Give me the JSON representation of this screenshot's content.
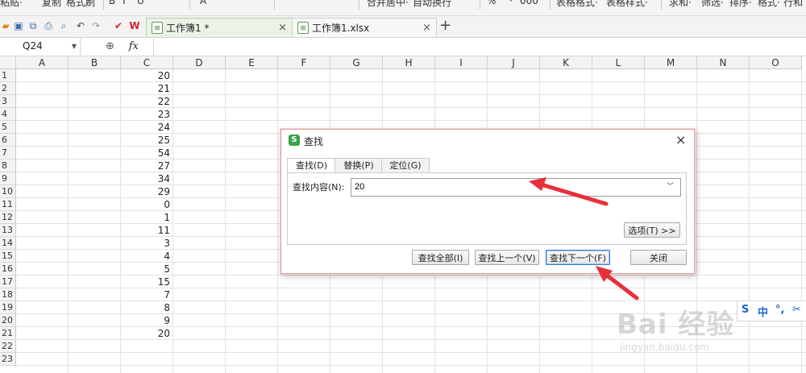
{
  "ribbon": {
    "items": [
      "粘贴·",
      "复制",
      "格式刷",
      "B",
      "I",
      "U",
      "A",
      "合并居中·",
      "自动换行",
      "%",
      "·",
      "000",
      "表格格式·",
      "表格样式·",
      "求和·",
      "筛选·",
      "排序·",
      "格式·",
      "行和"
    ]
  },
  "tabs": [
    {
      "label": "工作簿1 *",
      "active": true
    },
    {
      "label": "工作簿1.xlsx",
      "active": false
    }
  ],
  "tab_close": "×",
  "new_tab": "+",
  "cell_reference": "Q24",
  "fx_label": "fx",
  "columns": [
    "A",
    "B",
    "C",
    "D",
    "E",
    "F",
    "G",
    "H",
    "I",
    "J",
    "K",
    "L",
    "M",
    "N",
    "O"
  ],
  "rows": [
    "1",
    "2",
    "3",
    "4",
    "5",
    "6",
    "7",
    "8",
    "9",
    "10",
    "11",
    "12",
    "13",
    "14",
    "15",
    "16",
    "17",
    "18",
    "19",
    "20",
    "21",
    "22",
    "23"
  ],
  "column_c_values": [
    "20",
    "21",
    "22",
    "23",
    "24",
    "25",
    "54",
    "27",
    "34",
    "29",
    "0",
    "1",
    "11",
    "3",
    "4",
    "5",
    "15",
    "7",
    "8",
    "9",
    "20",
    "",
    ""
  ],
  "dialog": {
    "title": "查找",
    "logo": "S",
    "close": "×",
    "tabs": [
      "查找(D)",
      "替换(P)",
      "定位(G)"
    ],
    "find_label": "查找内容(N):",
    "find_value": "20",
    "options_button": "选项(T) >>",
    "find_all_button": "查找全部(I)",
    "find_prev_button": "查找上一个(V)",
    "find_next_button": "查找下一个(F)",
    "close_button": "关闭"
  },
  "ime": {
    "logo": "S",
    "lang": "中",
    "punct": "°,",
    "tool": "✂"
  },
  "watermark": {
    "brand": "Bai 经验",
    "url": "jingyan.baidu.com"
  },
  "colors": {
    "accent": "#3aa24a",
    "arrow": "#e8303a",
    "focus": "#3b7bd4"
  }
}
